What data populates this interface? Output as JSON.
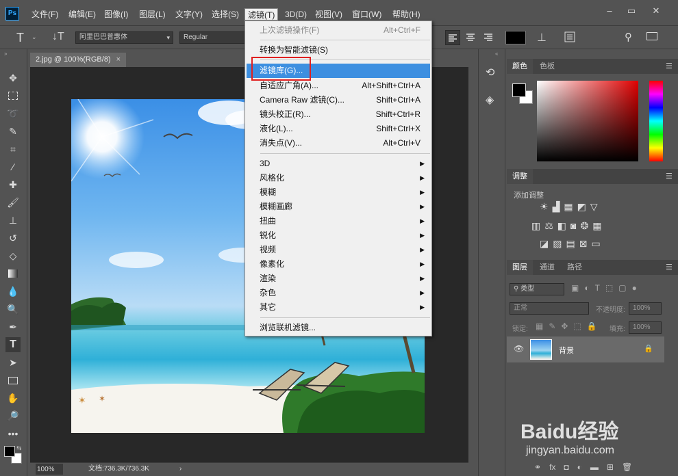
{
  "menubar": {
    "items": [
      "文件(F)",
      "编辑(E)",
      "图像(I)",
      "图层(L)",
      "文字(Y)",
      "选择(S)",
      "滤镜(T)",
      "3D(D)",
      "视图(V)",
      "窗口(W)",
      "帮助(H)"
    ],
    "active": "滤镜(T)",
    "logo": "Ps"
  },
  "options": {
    "tool_glyph": "T",
    "font_family": "阿里巴巴普惠体",
    "font_style": "Regular"
  },
  "document": {
    "tab_title": "2.jpg @ 100%(RGB/8)",
    "tab_close": "×",
    "zoom": "100%",
    "doc_info": "文档:736.3K/736.3K"
  },
  "filter_menu": {
    "items": [
      {
        "label": "上次滤镜操作(F)",
        "shortcut": "Alt+Ctrl+F",
        "disabled": true
      },
      {
        "label": "转换为智能滤镜(S)",
        "shortcut": ""
      },
      {
        "label": "滤镜库(G)...",
        "shortcut": "",
        "highlighted": true
      },
      {
        "label": "自适应广角(A)...",
        "shortcut": "Alt+Shift+Ctrl+A"
      },
      {
        "label": "Camera Raw 滤镜(C)...",
        "shortcut": "Shift+Ctrl+A"
      },
      {
        "label": "镜头校正(R)...",
        "shortcut": "Shift+Ctrl+R"
      },
      {
        "label": "液化(L)...",
        "shortcut": "Shift+Ctrl+X"
      },
      {
        "label": "消失点(V)...",
        "shortcut": "Alt+Ctrl+V"
      },
      {
        "label": "3D",
        "submenu": true
      },
      {
        "label": "风格化",
        "submenu": true
      },
      {
        "label": "模糊",
        "submenu": true
      },
      {
        "label": "模糊画廊",
        "submenu": true
      },
      {
        "label": "扭曲",
        "submenu": true
      },
      {
        "label": "锐化",
        "submenu": true
      },
      {
        "label": "视频",
        "submenu": true
      },
      {
        "label": "像素化",
        "submenu": true
      },
      {
        "label": "渲染",
        "submenu": true
      },
      {
        "label": "杂色",
        "submenu": true
      },
      {
        "label": "其它",
        "submenu": true
      },
      {
        "label": "浏览联机滤镜..."
      }
    ]
  },
  "panels": {
    "color_tabs": [
      "颜色",
      "色板"
    ],
    "adjust_title": "调整",
    "adjust_add": "添加调整",
    "layer_tabs": [
      "图层",
      "通道",
      "路径"
    ],
    "filter_kind": "类型",
    "blend_mode": "正常",
    "opacity_label": "不透明度:",
    "opacity_value": "100%",
    "lock_label": "锁定:",
    "fill_label": "填充:",
    "fill_value": "100%",
    "layer_name": "背景"
  },
  "watermark": {
    "brand": "Baidu经验",
    "url": "jingyan.baidu.com"
  },
  "colors": {
    "highlight": "#3d8fe0",
    "annotation_box": "#e02020"
  }
}
